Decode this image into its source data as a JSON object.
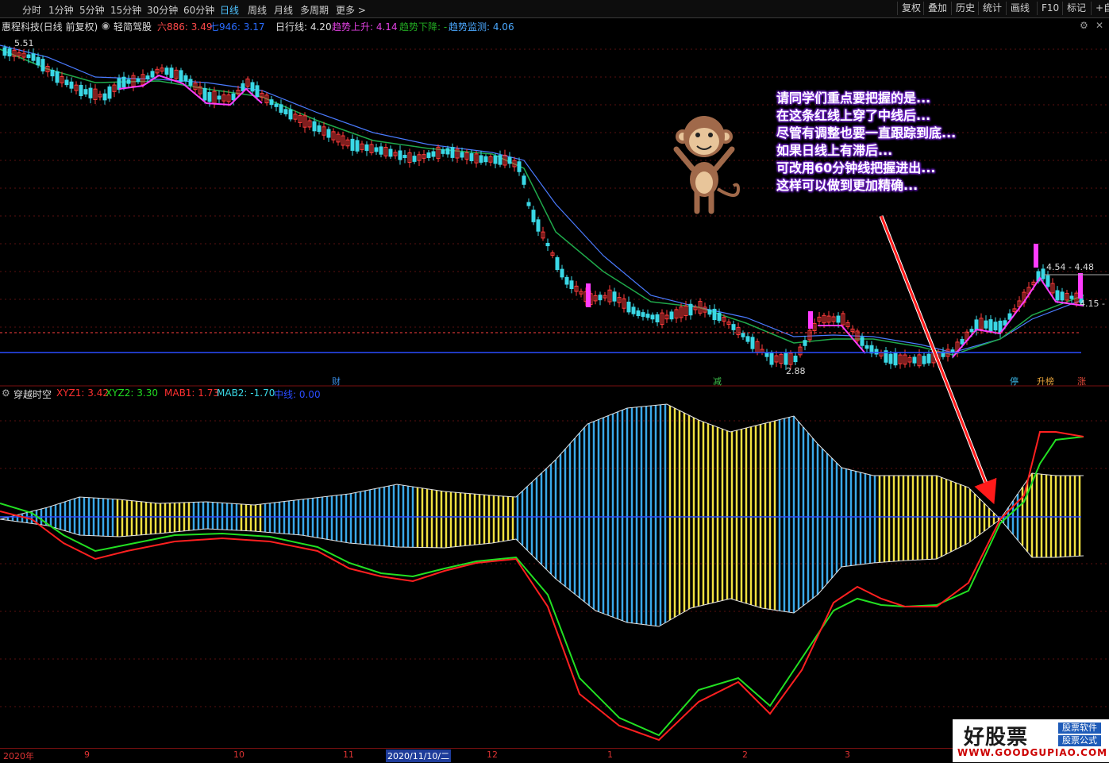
{
  "periods": [
    "分时",
    "1分钟",
    "5分钟",
    "15分钟",
    "30分钟",
    "60分钟",
    "日线",
    "周线",
    "月线",
    "多周期",
    "更多 >"
  ],
  "active_period": "日线",
  "right_buttons": [
    "复权",
    "叠加",
    "历史",
    "统计",
    "画线",
    "F10",
    "标记",
    "+自选"
  ],
  "info": {
    "stock": "惠程科技(日线 前复权)",
    "plugin": "轻简驾股",
    "v1": "六886: 3.49",
    "v2": "七946: 3.17",
    "daily": "日行线: 4.20",
    "up": "趋势上升: 4.14",
    "down": "趋势下降: -",
    "monitor": "趋势监测: 4.06"
  },
  "price_labels": {
    "high": "5.51",
    "low": "2.88",
    "range": "4.54 - 4.48",
    "last": "4.15 -"
  },
  "markers": [
    {
      "text": "财",
      "color": "#3a8ee6"
    },
    {
      "text": "减",
      "color": "#3cc04a"
    },
    {
      "text": "停",
      "color": "#3ab6e6"
    },
    {
      "text": "升榜",
      "color": "#e6a23a"
    },
    {
      "text": "涨",
      "color": "#e64a3a"
    }
  ],
  "indicator": {
    "name": "穿越时空",
    "xyz1": "XYZ1: 3.42",
    "xyz2": "XYZ2: 3.30",
    "mab1": "MAB1: 1.73",
    "mab2": "MAB2: -1.70",
    "mid": "中线: 0.00"
  },
  "annotation": [
    "请同学们重点要把握的是...",
    "在这条红线上穿了中线后...",
    "尽管有调整也要一直跟踪到底...",
    "如果日线上有滞后...",
    "可改用60分钟线把握进出...",
    "这样可以做到更加精确..."
  ],
  "x_labels": [
    "2020年",
    "9",
    "10",
    "11",
    "2020/11/10/二",
    "12",
    "1",
    "2",
    "3"
  ],
  "watermark": {
    "main": "好股票",
    "url": "WWW.GOODGUPIAO.COM",
    "tag1": "股票软件",
    "tag2": "股票公式"
  },
  "colors": {
    "up": "#ff3b3b",
    "down": "#3ad8e6",
    "mid": "#2a4cff",
    "xyz1": "#ff2020",
    "xyz2": "#22e022",
    "bar_blue": "#3aa8e8",
    "bar_yellow": "#f0e040"
  },
  "icons": [
    "eye-icon",
    "monkey-icon",
    "arrow-icon"
  ]
}
